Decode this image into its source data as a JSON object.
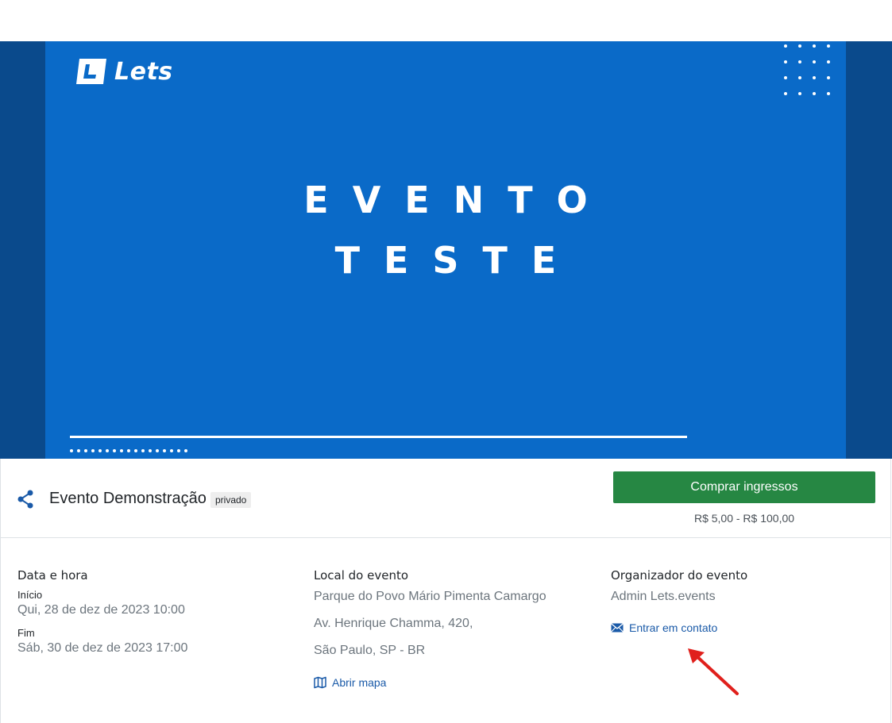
{
  "banner": {
    "logo_text": "Lets",
    "title_line1": "EVENTO",
    "title_line2": "TESTE"
  },
  "event": {
    "name": "Evento Demonstração",
    "privacy_badge": "privado",
    "buy_button_label": "Comprar ingressos",
    "price_range": "R$ 5,00 - R$ 100,00"
  },
  "datetime": {
    "title": "Data e hora",
    "start_label": "Início",
    "start_value": "Qui, 28 de dez de 2023 10:00",
    "end_label": "Fim",
    "end_value": "Sáb, 30 de dez de 2023 17:00"
  },
  "location": {
    "title": "Local do evento",
    "venue": "Parque do Povo Mário Pimenta Camargo",
    "street": "Av. Henrique Chamma, 420,",
    "city": "São Paulo, SP - BR",
    "map_link": "Abrir mapa"
  },
  "organizer": {
    "title": "Organizador do evento",
    "name": "Admin Lets.events",
    "contact_link": "Entrar em contato"
  },
  "colors": {
    "banner_outer": "#0a4a8c",
    "banner_inner": "#0a6ac8",
    "buy_button": "#268743",
    "link": "#1a5aa8",
    "annotation_arrow": "#e0201c"
  },
  "icons": {
    "share": "share-icon",
    "map": "map-icon",
    "mail": "mail-icon"
  }
}
